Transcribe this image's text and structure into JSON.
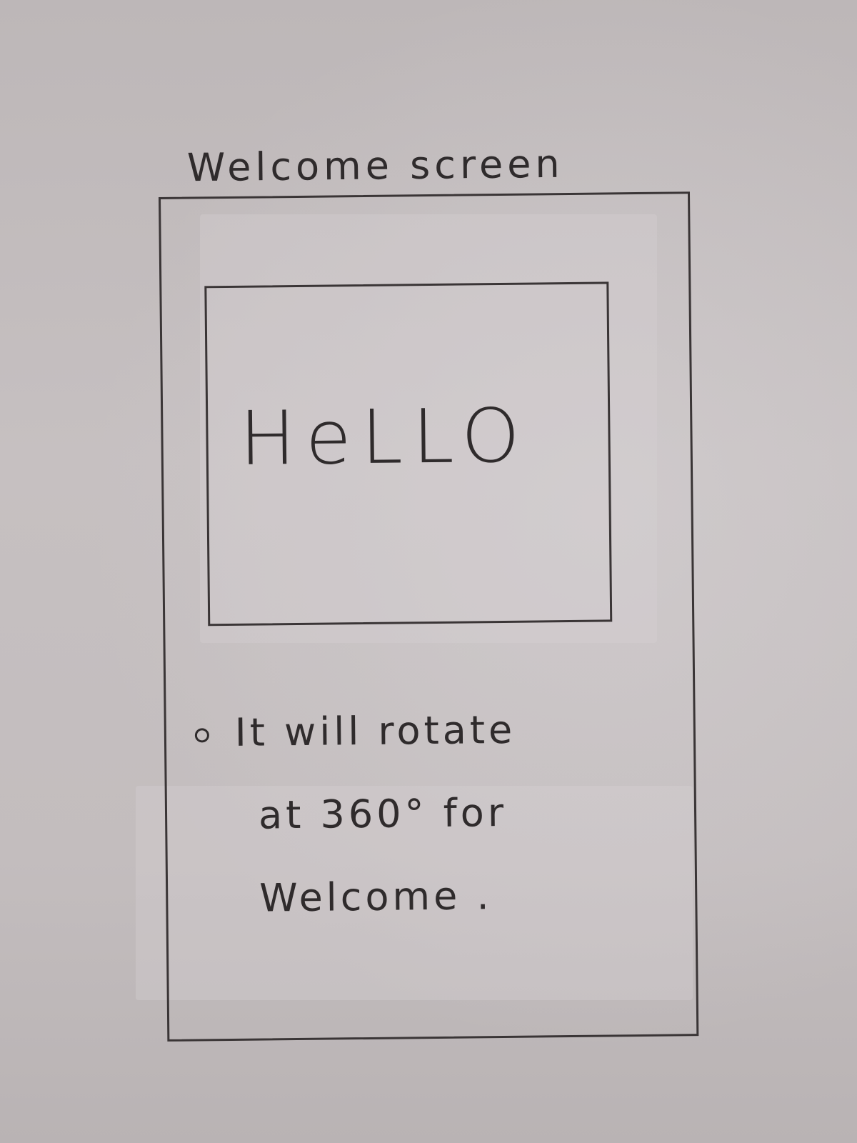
{
  "sketch": {
    "title": "Welcome screen",
    "hello_text": "HeLLO",
    "description_lines": [
      "It  will  rotate",
      "at 360° for",
      "Welcome ."
    ]
  }
}
